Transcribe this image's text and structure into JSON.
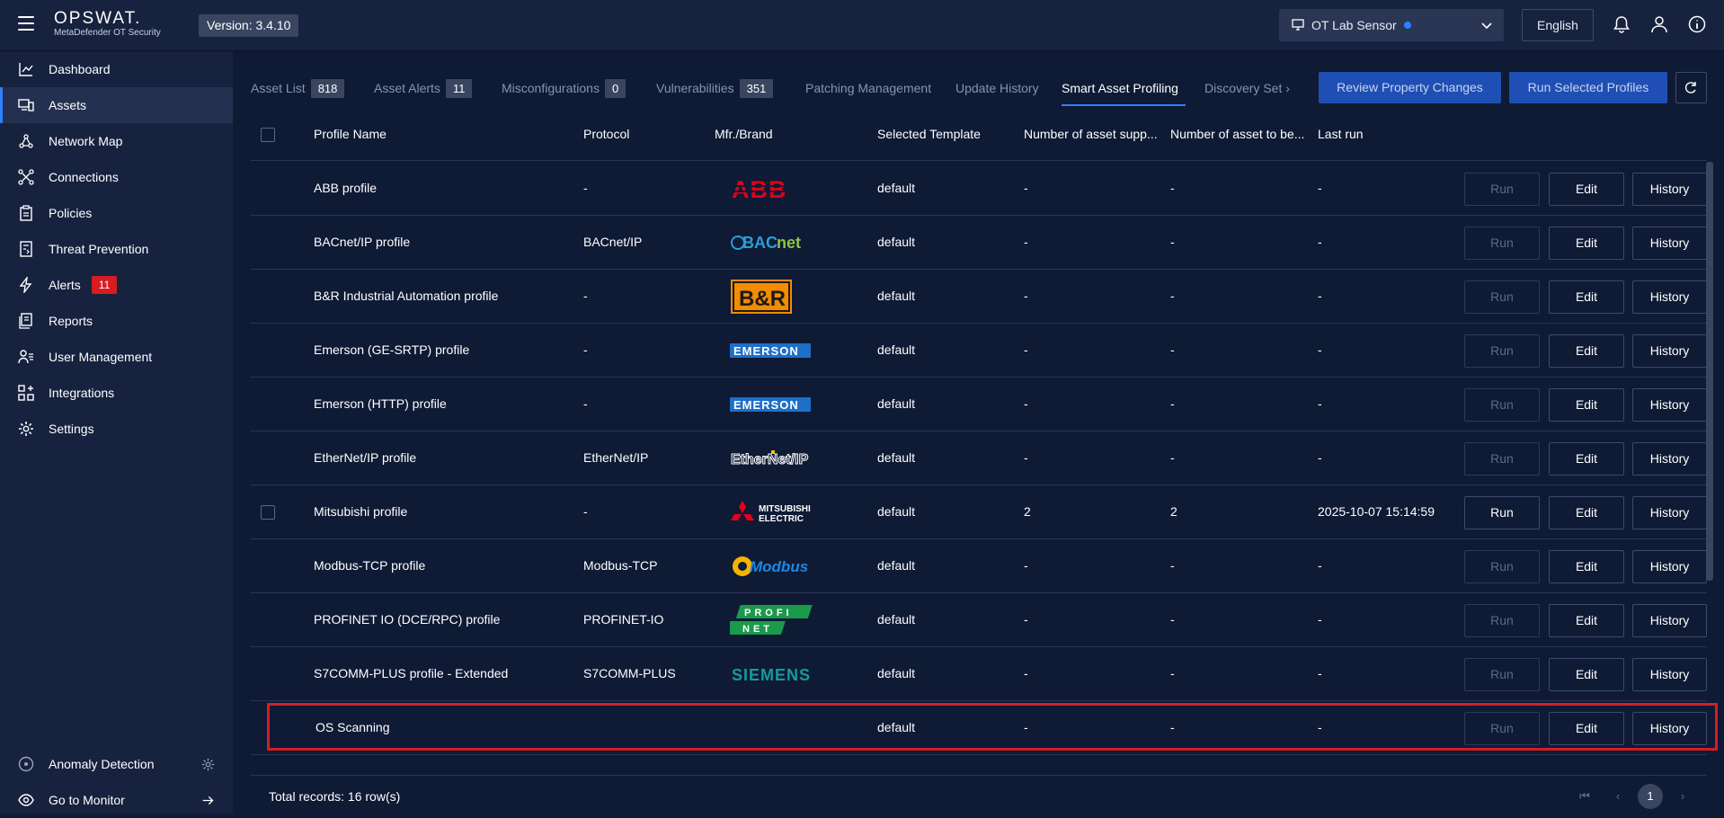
{
  "header": {
    "brand_name": "OPSWAT.",
    "brand_sub": "MetaDefender OT Security",
    "version": "Version: 3.4.10",
    "sensor_name": "OT Lab Sensor",
    "language": "English"
  },
  "sidebar": {
    "items": [
      {
        "label": "Dashboard"
      },
      {
        "label": "Assets"
      },
      {
        "label": "Network Map"
      },
      {
        "label": "Connections"
      },
      {
        "label": "Policies"
      },
      {
        "label": "Threat Prevention"
      },
      {
        "label": "Alerts",
        "badge": "11"
      },
      {
        "label": "Reports"
      },
      {
        "label": "User Management"
      },
      {
        "label": "Integrations"
      },
      {
        "label": "Settings"
      }
    ],
    "bottom": [
      {
        "label": "Anomaly Detection"
      },
      {
        "label": "Go to Monitor"
      }
    ]
  },
  "tabs": [
    {
      "label": "Asset List",
      "count": "818"
    },
    {
      "label": "Asset Alerts",
      "count": "11"
    },
    {
      "label": "Misconfigurations",
      "count": "0"
    },
    {
      "label": "Vulnerabilities",
      "count": "351"
    },
    {
      "label": "Patching Management"
    },
    {
      "label": "Update History"
    },
    {
      "label": "Smart Asset Profiling"
    },
    {
      "label": "Discovery Set"
    }
  ],
  "actions": {
    "review": "Review Property Changes",
    "run_selected": "Run Selected Profiles"
  },
  "table": {
    "columns": [
      "Profile Name",
      "Protocol",
      "Mfr./Brand",
      "Selected Template",
      "Number of asset supp...",
      "Number of asset to be...",
      "Last run"
    ],
    "rows": [
      {
        "name": "ABB profile",
        "protocol": "-",
        "brand": "ABB",
        "template": "default",
        "n1": "-",
        "n2": "-",
        "last": "-"
      },
      {
        "name": "BACnet/IP profile",
        "protocol": "BACnet/IP",
        "brand": "BACnet",
        "template": "default",
        "n1": "-",
        "n2": "-",
        "last": "-"
      },
      {
        "name": "B&R Industrial Automation profile",
        "protocol": "-",
        "brand": "B&R",
        "template": "default",
        "n1": "-",
        "n2": "-",
        "last": "-"
      },
      {
        "name": "Emerson (GE-SRTP) profile",
        "protocol": "-",
        "brand": "EMERSON",
        "template": "default",
        "n1": "-",
        "n2": "-",
        "last": "-"
      },
      {
        "name": "Emerson (HTTP) profile",
        "protocol": "-",
        "brand": "EMERSON",
        "template": "default",
        "n1": "-",
        "n2": "-",
        "last": "-"
      },
      {
        "name": "EtherNet/IP profile",
        "protocol": "EtherNet/IP",
        "brand": "EtherNet/IP",
        "template": "default",
        "n1": "-",
        "n2": "-",
        "last": "-"
      },
      {
        "name": "Mitsubishi profile",
        "protocol": "-",
        "brand": "MITSUBISHI ELECTRIC",
        "template": "default",
        "n1": "2",
        "n2": "2",
        "last": "2025-10-07 15:14:59"
      },
      {
        "name": "Modbus-TCP profile",
        "protocol": "Modbus-TCP",
        "brand": "Modbus",
        "template": "default",
        "n1": "-",
        "n2": "-",
        "last": "-"
      },
      {
        "name": "PROFINET IO (DCE/RPC) profile",
        "protocol": "PROFINET-IO",
        "brand": "PROFI NET",
        "template": "default",
        "n1": "-",
        "n2": "-",
        "last": "-"
      },
      {
        "name": "S7COMM-PLUS profile - Extended",
        "protocol": "S7COMM-PLUS",
        "brand": "SIEMENS",
        "template": "default",
        "n1": "-",
        "n2": "-",
        "last": "-"
      },
      {
        "name": "OS Scanning",
        "protocol": "",
        "brand": "",
        "template": "default",
        "n1": "-",
        "n2": "-",
        "last": "-"
      }
    ],
    "btn_run": "Run",
    "btn_edit": "Edit",
    "btn_history": "History"
  },
  "footer": {
    "total": "Total records: 16 row(s)",
    "page": "1"
  },
  "colors": {
    "accent": "#2f80ff",
    "alert": "#d51d22",
    "bg": "#0f1a35"
  }
}
